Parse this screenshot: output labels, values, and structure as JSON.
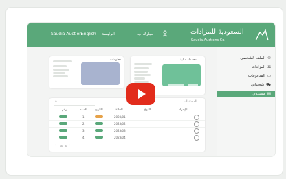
{
  "header": {
    "logo_title": "السعودية للمزادات",
    "logo_subtitle": "Saudia Auctions Co.",
    "user_greeting": "مبارك ب",
    "nav_home": "الرئيسة",
    "nav_english": "English",
    "nav_alt": "Saudia Auction"
  },
  "sidebar": {
    "items": [
      {
        "label": "الملف الشخصي"
      },
      {
        "label": "المزادات"
      },
      {
        "label": "المدفوعات"
      },
      {
        "label": "شحنياتي"
      },
      {
        "label": "مستندي"
      }
    ]
  },
  "wallet": {
    "title": "محفظة مالية"
  },
  "info": {
    "title": "معلومات"
  },
  "docs": {
    "title": "المستندات",
    "columns": [
      "رقم",
      "الاسم",
      "التاريخ",
      "الحالة",
      "النوع",
      "الإجراء"
    ],
    "rows": [
      {
        "id": "1",
        "date": "2023/01"
      },
      {
        "id": "2",
        "date": "2023/02"
      },
      {
        "id": "3",
        "date": "2023/03"
      },
      {
        "id": "4",
        "date": "2023/04"
      }
    ]
  },
  "colors": {
    "brand": "#5aa87a",
    "card": "#6fc199",
    "card_alt": "#a8b3cf",
    "play": "#e22c1c"
  }
}
